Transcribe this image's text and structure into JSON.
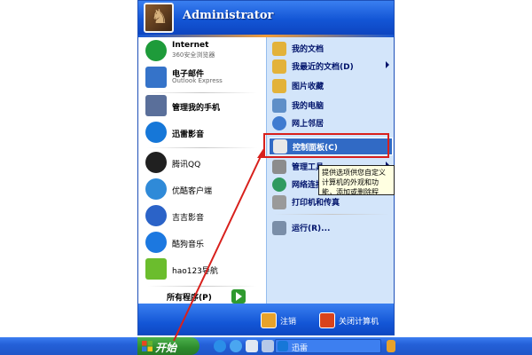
{
  "user": {
    "name": "Administrator"
  },
  "pinned": [
    {
      "title": "Internet",
      "subtitle": "360安全浏览器",
      "icon": "internet-icon",
      "color": "#1e9b3a"
    },
    {
      "title": "电子邮件",
      "subtitle": "Outlook Express",
      "icon": "email-icon",
      "color": "#3573c9"
    }
  ],
  "recent": [
    {
      "label": "管理我的手机",
      "icon": "phone-manager-icon",
      "color": "#5a6f9a"
    },
    {
      "label": "迅雷影音",
      "icon": "xunlei-icon",
      "color": "#1677d8"
    },
    {
      "label": "腾讯QQ",
      "icon": "qq-icon",
      "color": "#202020"
    },
    {
      "label": "优酷客户端",
      "icon": "youku-icon",
      "color": "#2f8ad8"
    },
    {
      "label": "吉吉影音",
      "icon": "jijiyingyin-icon",
      "color": "#2b63c8"
    },
    {
      "label": "酷狗音乐",
      "icon": "kugou-icon",
      "color": "#1c78e0"
    },
    {
      "label": "hao123导航",
      "icon": "hao123-icon",
      "color": "#6bbd2d",
      "badge": "hao 123"
    }
  ],
  "all_programs": {
    "label": "所有程序(P)"
  },
  "right": [
    {
      "label": "我的文档",
      "icon": "my-documents-icon",
      "color": "#e3b23a"
    },
    {
      "label": "我最近的文档(D)",
      "icon": "recent-documents-icon",
      "color": "#e3b23a",
      "submenu": true
    },
    {
      "label": "图片收藏",
      "icon": "my-pictures-icon",
      "color": "#e3b23a"
    },
    {
      "label": "我的电脑",
      "icon": "my-computer-icon",
      "color": "#5f8fc8"
    },
    {
      "label": "网上邻居",
      "icon": "network-places-icon",
      "color": "#3f7bd0"
    },
    {
      "label": "控制面板(C)",
      "icon": "control-panel-icon",
      "color": "#e8e8e8",
      "highlighted": true
    },
    {
      "label": "管理工具",
      "icon": "admin-tools-icon",
      "color": "#8c8c8c",
      "submenu": true
    },
    {
      "label": "网络连接",
      "icon": "network-connections-icon",
      "color": "#2f9a5f"
    },
    {
      "label": "打印机和传真",
      "icon": "printers-icon",
      "color": "#9a9a9a"
    },
    {
      "label": "运行(R)...",
      "icon": "run-icon",
      "color": "#7a8ea8"
    }
  ],
  "tooltip": {
    "text": "提供选项供您自定义计算机的外观和功能，添加或删除程序，设置网络连接和用户帐户。"
  },
  "footer": {
    "logoff": "注销",
    "shutdown": "关闭计算机"
  },
  "taskbar": {
    "start": "开始",
    "task": "迅雷"
  },
  "colors": {
    "accent": "#316ac5",
    "taskbar": "#2460d8",
    "start": "#2d8b2d",
    "annotation": "#d8201c"
  }
}
